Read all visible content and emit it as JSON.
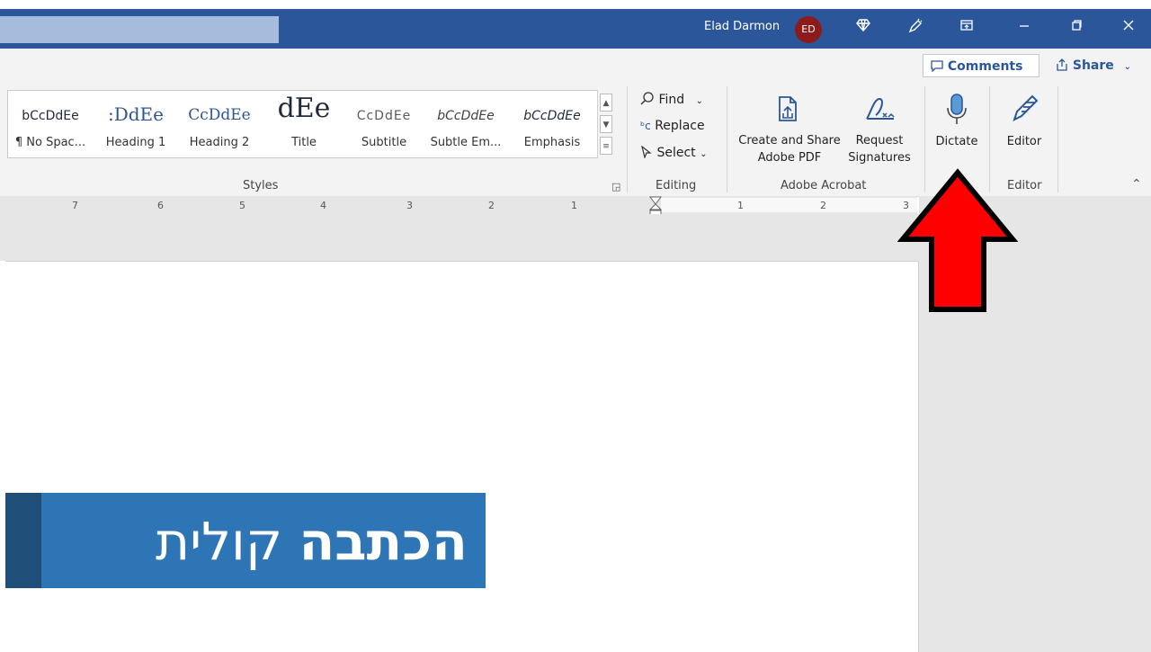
{
  "titlebar": {
    "user_name": "Elad Darmon",
    "avatar_initials": "ED",
    "icons": [
      "diamond-icon",
      "pen-sparkle-icon",
      "ribbon-display-icon",
      "minimize-icon",
      "restore-icon",
      "close-icon"
    ]
  },
  "ribbon": {
    "comments_label": "Comments",
    "share_label": "Share",
    "styles": [
      {
        "sample": "bCcDdEe",
        "name": "¶ No Spac..."
      },
      {
        "sample": ":DdEe",
        "name": "Heading 1"
      },
      {
        "sample": "CcDdEe",
        "name": "Heading 2"
      },
      {
        "sample": "dEe",
        "name": "Title"
      },
      {
        "sample": "CcDdEe",
        "name": "Subtitle"
      },
      {
        "sample": "bCcDdEe",
        "name": "Subtle Em..."
      },
      {
        "sample": "bCcDdEe",
        "name": "Emphasis"
      }
    ],
    "groups": {
      "styles": "Styles",
      "editing": "Editing",
      "acrobat": "Adobe Acrobat",
      "editor": "Editor"
    },
    "editing": {
      "find": "Find",
      "replace": "Replace",
      "select": "Select"
    },
    "acrobat": {
      "create_share_line1": "Create and Share",
      "create_share_line2": "Adobe PDF",
      "request_line1": "Request",
      "request_line2": "Signatures"
    },
    "dictate_label": "Dictate",
    "editor_label": "Editor"
  },
  "ruler": {
    "ticks": [
      "7",
      "6",
      "5",
      "4",
      "3",
      "2",
      "1",
      "1",
      "2",
      "3"
    ]
  },
  "banner": {
    "bold_word": "הכתבה",
    "regular_word": "קולית"
  },
  "colors": {
    "titlebar": "#2b579a",
    "arrow": "#ff0000",
    "banner": "#2e75b6",
    "banner_strip": "#1f4e79"
  }
}
